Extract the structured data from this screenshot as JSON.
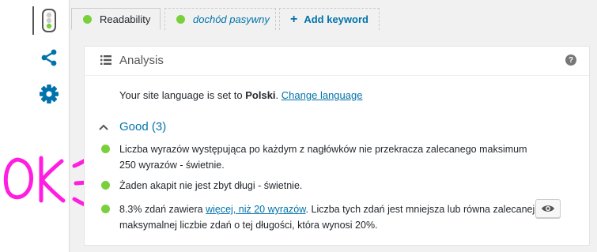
{
  "rail": {
    "items": [
      {
        "icon": "traffic-light-icon",
        "active": true
      },
      {
        "icon": "share-icon",
        "active": false
      },
      {
        "icon": "gear-icon",
        "active": false
      }
    ]
  },
  "annotation": {
    "text": "OK"
  },
  "tabs": [
    {
      "label": "Readability",
      "status": "good"
    },
    {
      "label": "dochód pasywny",
      "status": "good"
    },
    {
      "label": "Add keyword",
      "prefix": "+"
    }
  ],
  "panel": {
    "title": "Analysis",
    "language": {
      "prefix": "Your site language is set to ",
      "value": "Polski",
      "suffix": ".",
      "change_link": "Change language"
    },
    "group": {
      "label": "Good (3)"
    },
    "items": [
      {
        "text": "Liczba wyrazów występująca po każdym z nagłówków nie przekracza zalecanego maksimum 250 wyrazów - świetnie."
      },
      {
        "text": "Żaden akapit nie jest zbyt długi - świetnie."
      },
      {
        "text_before": "8.3% zdań zawiera ",
        "link": "więcej, niż 20 wyrazów",
        "text_after": ". Liczba tych zdań jest mniejsza lub równa zalecanej maksymalnej liczbie zdań o tej długości, która wynosi 20%."
      }
    ]
  },
  "colors": {
    "accent": "#0073aa",
    "good": "#7ad03a",
    "annotation": "#ff1ee0"
  }
}
